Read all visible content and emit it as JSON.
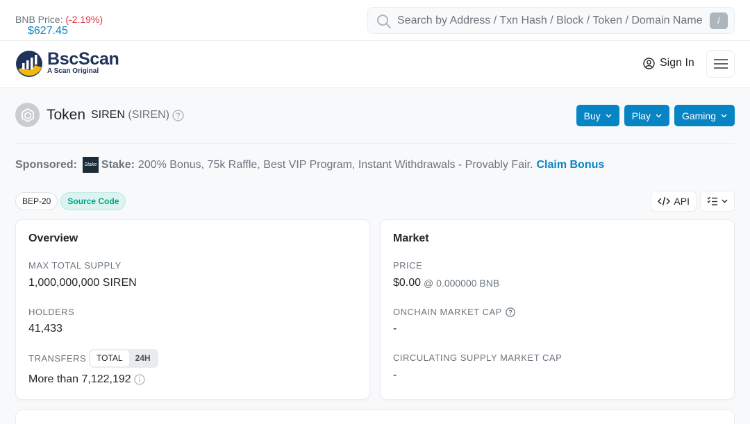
{
  "topbar": {
    "price_label": "BNB Price:",
    "price_value": "$627.45",
    "price_change": "(-2.19%)",
    "search_placeholder": "Search by Address / Txn Hash / Block / Token / Domain Name",
    "search_shortcut": "/"
  },
  "navbar": {
    "brand": "BscScan",
    "tagline": "A Scan Original",
    "signin": "Sign In"
  },
  "token": {
    "title": "Token",
    "name": "SIREN",
    "symbol": "(SIREN)",
    "actions": [
      "Buy",
      "Play",
      "Gaming"
    ]
  },
  "sponsor": {
    "label": "Sponsored:",
    "logo_text": "Stake",
    "name": "Stake:",
    "text": "200% Bonus, 75k Raffle, Best VIP Program, Instant Withdrawals - Provably Fair.",
    "cta": "Claim Bonus"
  },
  "badges": [
    "BEP-20",
    "Source Code"
  ],
  "tools": {
    "api": "API"
  },
  "overview": {
    "title": "Overview",
    "max_supply_label": "MAX TOTAL SUPPLY",
    "max_supply_value": "1,000,000,000 SIREN",
    "holders_label": "HOLDERS",
    "holders_value": "41,433",
    "transfers_label": "TRANSFERS",
    "transfers_tabs": [
      "TOTAL",
      "24H"
    ],
    "transfers_value": "More than 7,122,192"
  },
  "market": {
    "title": "Market",
    "price_label": "PRICE",
    "price_value": "$0.00",
    "price_bnb": "@ 0.000000 BNB",
    "mcap_label": "ONCHAIN MARKET CAP",
    "mcap_value": "-",
    "circ_label": "CIRCULATING SUPPLY MARKET CAP",
    "circ_value": "-"
  },
  "colors": {
    "accent": "#0784c3",
    "negative": "#dc3545",
    "source_badge": "#00a186"
  }
}
